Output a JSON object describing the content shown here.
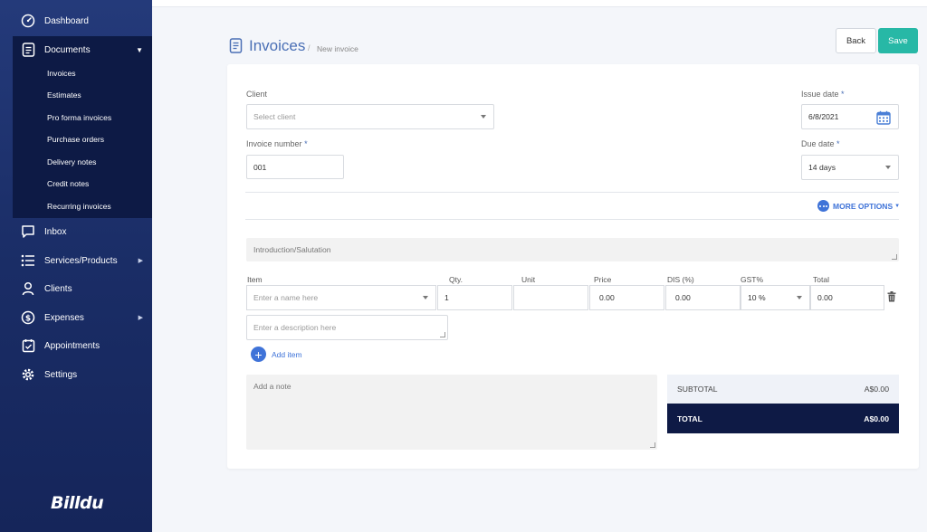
{
  "sidebar": {
    "items": [
      {
        "label": "Dashboard",
        "icon": "dashboard-icon"
      },
      {
        "label": "Documents",
        "icon": "document-icon"
      },
      {
        "label": "Inbox",
        "icon": "inbox-icon"
      },
      {
        "label": "Services/Products",
        "icon": "list-icon"
      },
      {
        "label": "Clients",
        "icon": "user-icon"
      },
      {
        "label": "Expenses",
        "icon": "dollar-icon"
      },
      {
        "label": "Appointments",
        "icon": "calendar-check-icon"
      },
      {
        "label": "Settings",
        "icon": "gear-icon"
      }
    ],
    "documents_sub": [
      "Invoices",
      "Estimates",
      "Pro forma invoices",
      "Purchase orders",
      "Delivery notes",
      "Credit notes",
      "Recurring invoices"
    ],
    "logo_text": "Billdu"
  },
  "header": {
    "title": "Invoices",
    "separator": "/",
    "breadcrumb": "New invoice",
    "back_label": "Back",
    "save_label": "Save"
  },
  "form": {
    "client_label": "Client",
    "client_placeholder": "Select client",
    "issue_date_label": "Issue date",
    "issue_date_value": "6/8/2021",
    "invoice_number_label": "Invoice number",
    "invoice_number_value": "001",
    "due_date_label": "Due date",
    "due_date_value": "14 days",
    "required_mark": "*",
    "more_options": "MORE OPTIONS",
    "intro_placeholder": "Introduction/Salutation"
  },
  "items_table": {
    "headers": [
      "Item",
      "Qty.",
      "Unit",
      "Price",
      "DIS (%)",
      "GST%",
      "Total"
    ],
    "row": {
      "item_placeholder": "Enter a name here",
      "qty": "1",
      "unit": "",
      "price": "0.00",
      "discount": "0.00",
      "gst": "10 %",
      "total": "0.00"
    },
    "description_placeholder": "Enter a description here",
    "add_item_label": "Add item"
  },
  "note": {
    "placeholder": "Add a note"
  },
  "totals": {
    "subtotal_label": "SUBTOTAL",
    "subtotal_value": "A$0.00",
    "total_label": "TOTAL",
    "total_value": "A$0.00"
  },
  "colors": {
    "accent": "#3f73d8",
    "save": "#27b8a6",
    "sidebar": "#1a2d66",
    "total_bar": "#0e1a45"
  }
}
